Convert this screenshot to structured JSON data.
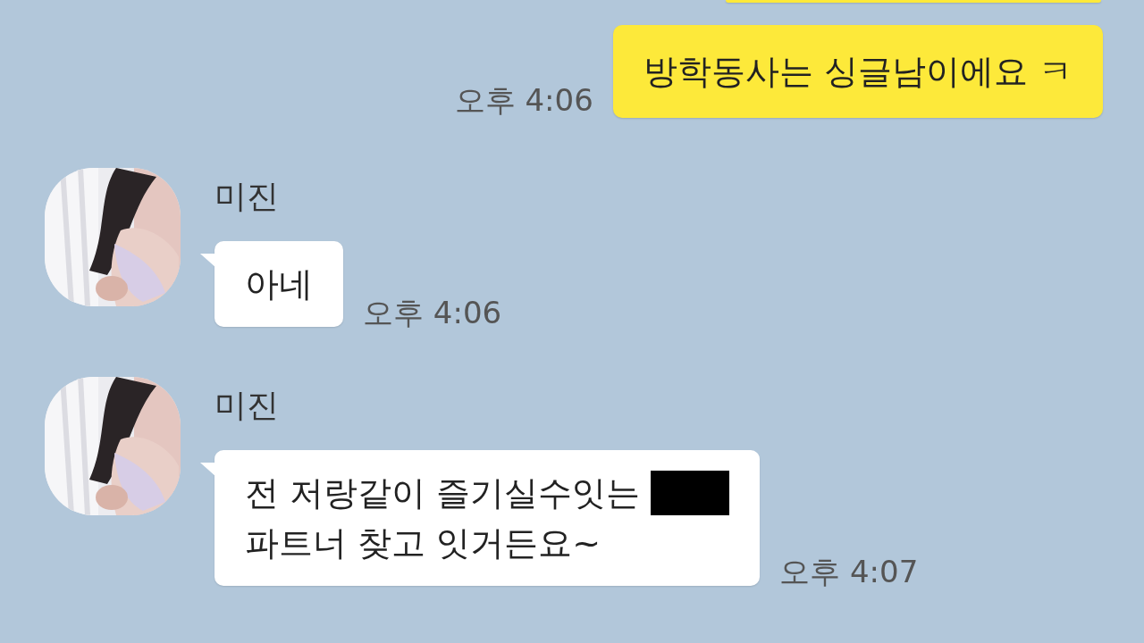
{
  "messages": [
    {
      "kind": "outgoing"
    },
    {
      "kind": "outgoing",
      "lines": [
        {
          "text": "방학동사는 싱글남이에요 ㅋ",
          "redacted": false
        }
      ],
      "time": "오후 4:06"
    },
    {
      "kind": "incoming",
      "sender": "미진",
      "lines": [
        {
          "text": "아네",
          "redacted": false
        }
      ],
      "time": "오후 4:06"
    },
    {
      "kind": "incoming",
      "sender": "미진",
      "lines": [
        {
          "text": "전 저랑같이 즐기실수잇는",
          "redacted": true
        },
        {
          "text": "파트너 찾고 잇거든요~",
          "redacted": false
        }
      ],
      "time": "오후 4:07"
    }
  ]
}
